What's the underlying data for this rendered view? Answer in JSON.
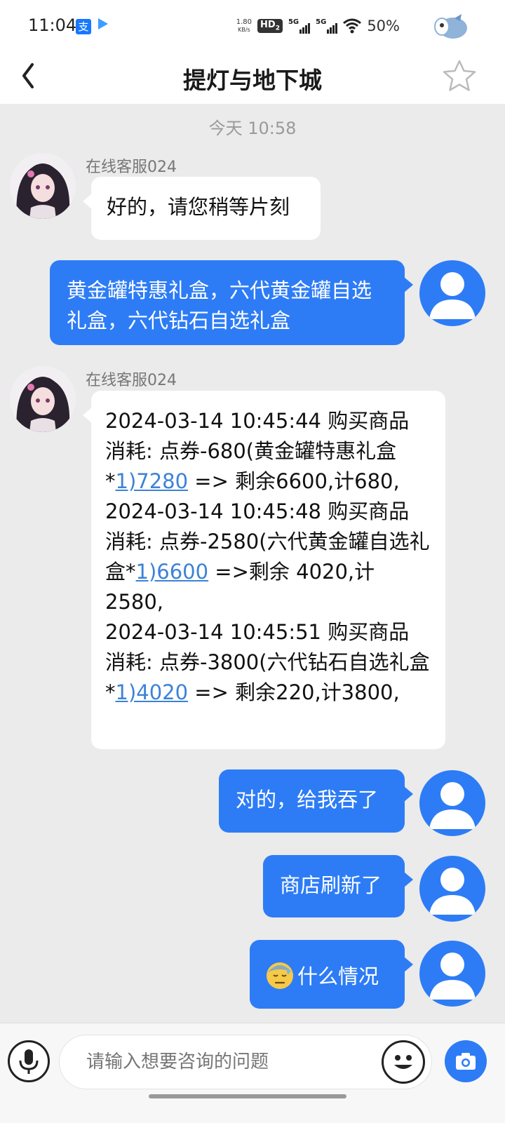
{
  "status_bar": {
    "time": "11:04",
    "alipay_icon_text": "支",
    "net_speed_value": "1.80",
    "net_speed_unit": "KB/s",
    "hd_label": "HD",
    "hd_sub": "2",
    "signal1_label": "5G",
    "signal2_label": "5G",
    "battery_percent": "50%"
  },
  "nav": {
    "title": "提灯与地下城"
  },
  "chat": {
    "timestamp": "今天 10:58",
    "messages": [
      {
        "side": "left",
        "sender": "在线客服024",
        "text": "好的，请您稍等片刻"
      },
      {
        "side": "right",
        "text": "黄金罐特惠礼盒，六代黄金罐自选礼盒，六代钻石自选礼盒"
      },
      {
        "side": "left",
        "sender": "在线客服024",
        "lines": [
          {
            "pre": "2024-03-14 10:45:44 购买商品 消耗: 点券-680(黄金罐特惠礼盒*",
            "link": "1)7280",
            "post": " => 剩余6600,计680,"
          },
          {
            "pre": "2024-03-14 10:45:48 购买商品 消耗: 点券-2580(六代黄金罐自选礼盒*",
            "link": "1)6600",
            "post": " =>剩余 4020,计2580,"
          },
          {
            "pre": "2024-03-14 10:45:51 购买商品 消耗: 点券-3800(六代钻石自选礼盒*",
            "link": "1)4020",
            "post": " => 剩余220,计3800,"
          }
        ]
      },
      {
        "side": "right",
        "text": "对的，给我吞了"
      },
      {
        "side": "right",
        "text": "商店刷新了"
      },
      {
        "side": "right",
        "emoji": "sweat-face",
        "text": "什么情况"
      }
    ]
  },
  "input_bar": {
    "placeholder": "请输入想要咨询的问题"
  },
  "colors": {
    "user_bubble": "#2d7cf6",
    "agent_bubble": "#ffffff",
    "background": "#ebebeb",
    "link": "#3d82d6"
  }
}
